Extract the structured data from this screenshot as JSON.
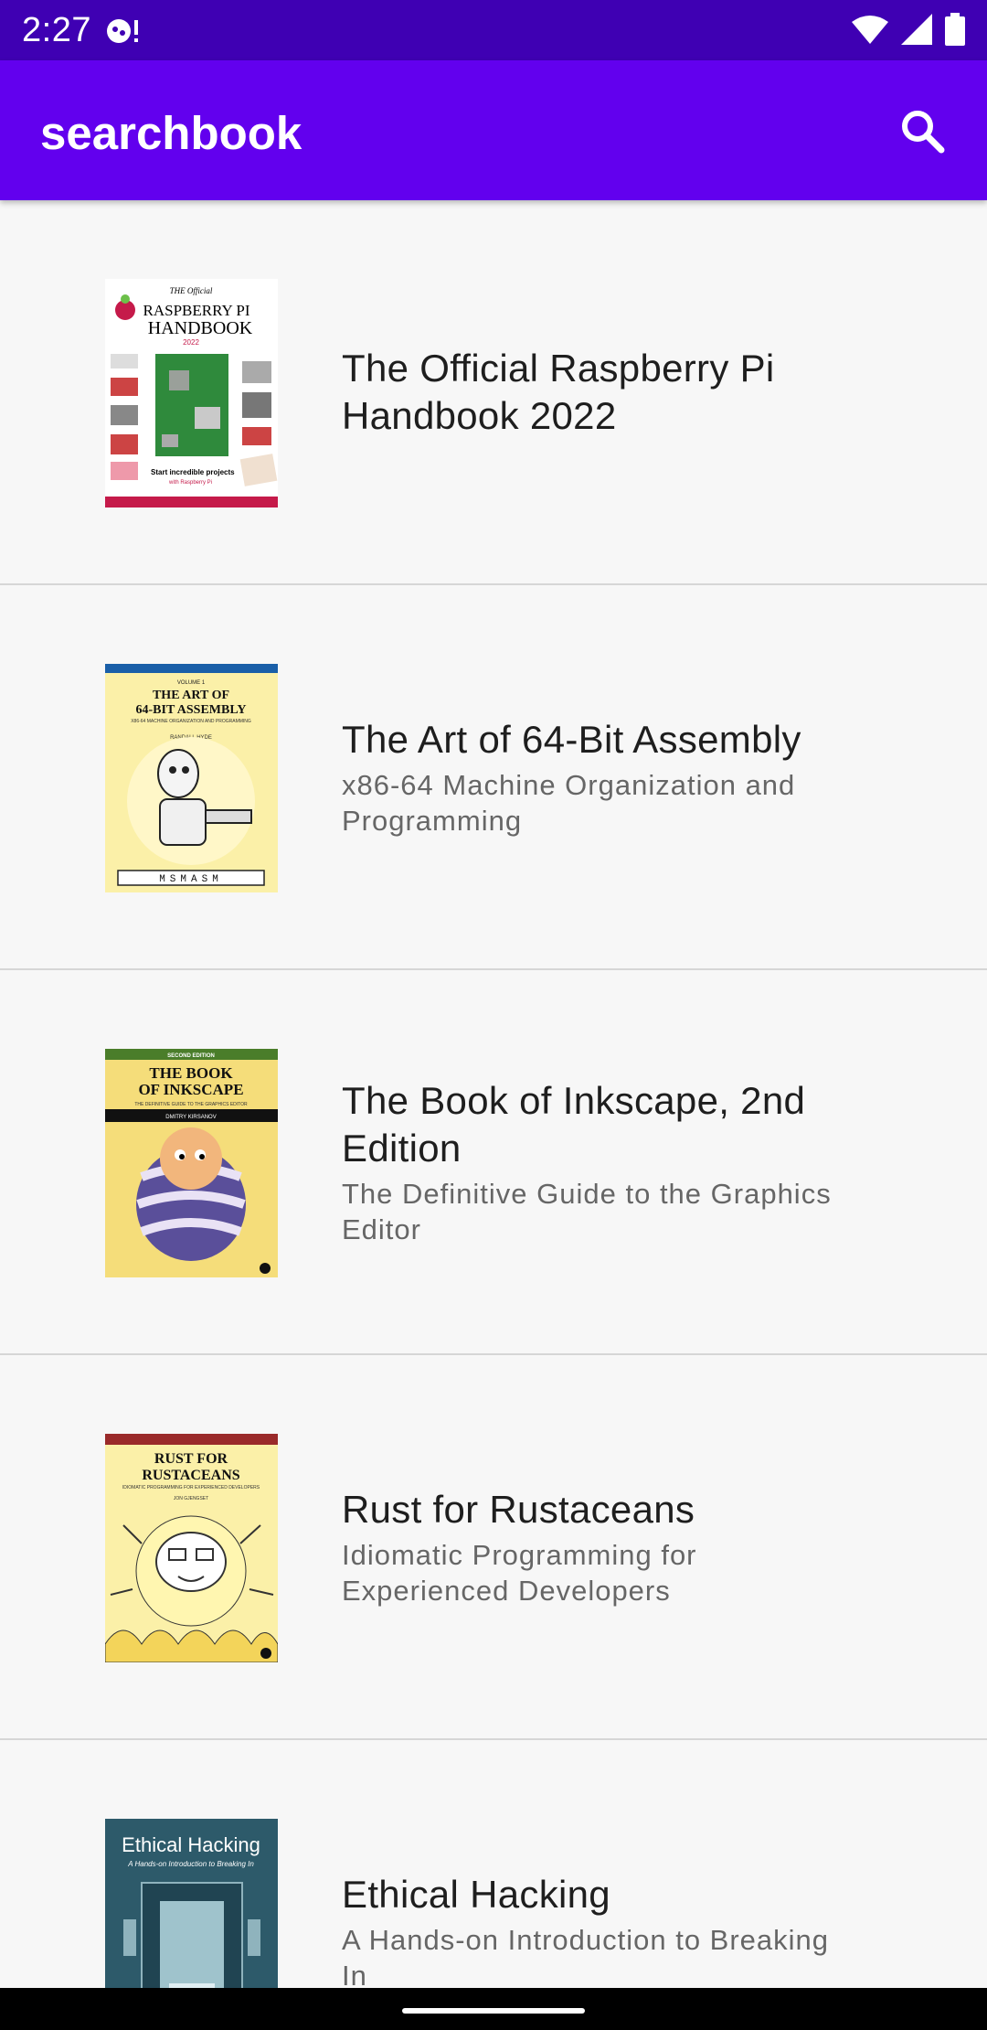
{
  "status_bar": {
    "time": "2:27",
    "icons": [
      "notification-icon",
      "wifi-icon",
      "signal-icon",
      "battery-icon"
    ]
  },
  "app_bar": {
    "title": "searchbook",
    "search_icon": "search-icon",
    "color": "#6200ee"
  },
  "books": [
    {
      "title": "The Official Raspberry Pi Handbook 2022",
      "subtitle": "",
      "cover": {
        "bg": "#ffffff",
        "lines": [
          "THE Official",
          "RASPBERRY PI",
          "HANDBOOK",
          "2022"
        ],
        "footer": "Start incredible projects with Raspberry Pi"
      }
    },
    {
      "title": "The Art of 64-Bit Assembly",
      "subtitle": "x86-64 Machine Organization and Programming",
      "cover": {
        "bg": "#fbf0a8",
        "lines": [
          "VOLUME 1",
          "THE ART OF",
          "64-BIT ASSEMBLY",
          "X86-64 MACHINE ORGANIZATION AND PROGRAMMING",
          "RANDALL HYDE"
        ],
        "footer": "MSMASM"
      }
    },
    {
      "title": "The Book of Inkscape, 2nd Edition",
      "subtitle": "The Definitive Guide to the Graphics Editor",
      "cover": {
        "bg": "#f5dd7a",
        "lines": [
          "SECOND EDITION",
          "THE BOOK",
          "OF INKSCAPE",
          "THE DEFINITIVE GUIDE TO THE GRAPHICS EDITOR",
          "DMITRY KIRSANOV"
        ],
        "footer": ""
      }
    },
    {
      "title": "Rust for Rustaceans",
      "subtitle": "Idiomatic Programming for Experienced Developers",
      "cover": {
        "bg": "#fbf0a8",
        "lines": [
          "RUST FOR",
          "RUSTACEANS",
          "IDIOMATIC PROGRAMMING FOR EXPERIENCED DEVELOPERS",
          "JON GJENGSET"
        ],
        "footer": ""
      }
    },
    {
      "title": "Ethical Hacking",
      "subtitle": "A Hands-on Introduction to Breaking In",
      "cover": {
        "bg": "#2d5a6a",
        "lines": [
          "Ethical Hacking",
          "A Hands-on Introduction to Breaking In"
        ],
        "footer": ""
      }
    }
  ]
}
